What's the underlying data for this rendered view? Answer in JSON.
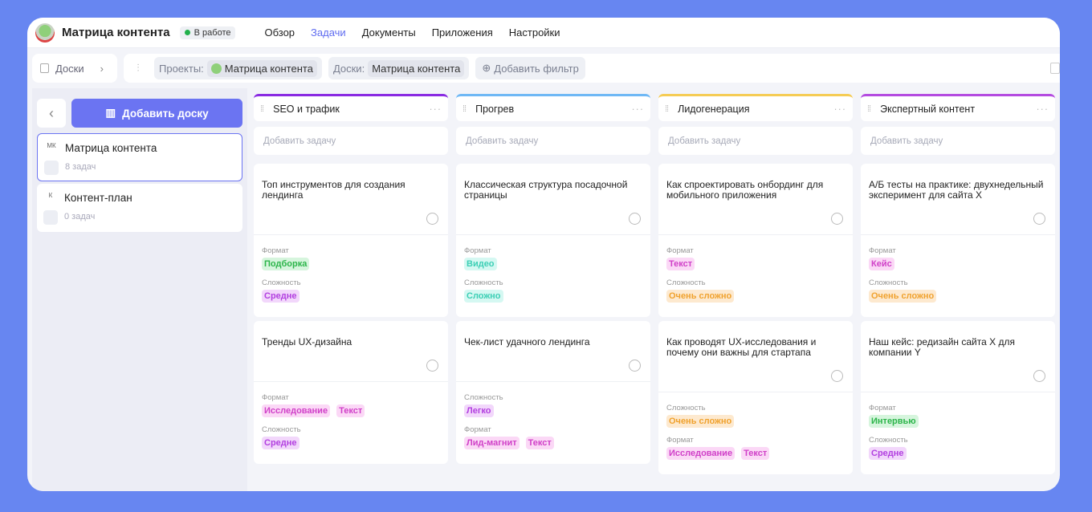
{
  "header": {
    "title": "Матрица контента",
    "status": "В работе",
    "nav": [
      "Обзор",
      "Задачи",
      "Документы",
      "Приложения",
      "Настройки"
    ],
    "active_nav": 1
  },
  "toolbar": {
    "boards_label": "Доски",
    "projects_label": "Проекты:",
    "projects_value": "Матрица контента",
    "boards_filter_label": "Доски:",
    "boards_filter_value": "Матрица контента",
    "add_filter": "Добавить фильтр"
  },
  "sidebar": {
    "add_board": "Добавить доску",
    "boards": [
      {
        "abbr": "МК",
        "name": "Матрица контента",
        "count": "8 задач",
        "selected": true
      },
      {
        "abbr": "К",
        "name": "Контент-план",
        "count": "0 задач",
        "selected": false
      }
    ]
  },
  "colors": {
    "accent": "#6b74f2",
    "background": "#6786f1"
  },
  "columns": [
    {
      "title": "SEO и трафик",
      "color": "#8a2be2",
      "add": "Добавить задачу",
      "cards": [
        {
          "title": "Топ инструментов для создания лендинга",
          "props": [
            {
              "label": "Формат",
              "tags": [
                {
                  "t": "Подборка",
                  "c": "green"
                }
              ]
            },
            {
              "label": "Сложность",
              "tags": [
                {
                  "t": "Средне",
                  "c": "purple"
                }
              ]
            }
          ]
        },
        {
          "title": "Тренды UX-дизайна",
          "props": [
            {
              "label": "Формат",
              "tags": [
                {
                  "t": "Исследование",
                  "c": "pink"
                },
                {
                  "t": "Текст",
                  "c": "pink"
                }
              ]
            },
            {
              "label": "Сложность",
              "tags": [
                {
                  "t": "Средне",
                  "c": "purple"
                }
              ]
            }
          ]
        }
      ]
    },
    {
      "title": "Прогрев",
      "color": "#6fb8f5",
      "add": "Добавить задачу",
      "cards": [
        {
          "title": "Классическая структура посадочной страницы",
          "props": [
            {
              "label": "Формат",
              "tags": [
                {
                  "t": "Видео",
                  "c": "teal"
                }
              ]
            },
            {
              "label": "Сложность",
              "tags": [
                {
                  "t": "Сложно",
                  "c": "teal"
                }
              ]
            }
          ]
        },
        {
          "title": "Чек-лист удачного лендинга",
          "props": [
            {
              "label": "Сложность",
              "tags": [
                {
                  "t": "Легко",
                  "c": "purple"
                }
              ]
            },
            {
              "label": "Формат",
              "tags": [
                {
                  "t": "Лид-магнит",
                  "c": "pink"
                },
                {
                  "t": "Текст",
                  "c": "pink"
                }
              ]
            }
          ]
        }
      ]
    },
    {
      "title": "Лидогенерация",
      "color": "#f5cc55",
      "add": "Добавить задачу",
      "cards": [
        {
          "title": "Как спроектировать онбординг для мобильного приложения",
          "props": [
            {
              "label": "Формат",
              "tags": [
                {
                  "t": "Текст",
                  "c": "pink"
                }
              ]
            },
            {
              "label": "Сложность",
              "tags": [
                {
                  "t": "Очень сложно",
                  "c": "orange"
                }
              ]
            }
          ]
        },
        {
          "title": "Как проводят UX-исследования и почему они важны для стартапа",
          "props": [
            {
              "label": "Сложность",
              "tags": [
                {
                  "t": "Очень сложно",
                  "c": "orange"
                }
              ]
            },
            {
              "label": "Формат",
              "tags": [
                {
                  "t": "Исследование",
                  "c": "pink"
                },
                {
                  "t": "Текст",
                  "c": "pink"
                }
              ]
            }
          ]
        }
      ]
    },
    {
      "title": "Экспертный контент",
      "color": "#b44be0",
      "add": "Добавить задачу",
      "cards": [
        {
          "title": "А/Б тесты на практике: двухнедельный эксперимент для сайта Х",
          "props": [
            {
              "label": "Формат",
              "tags": [
                {
                  "t": "Кейс",
                  "c": "pink"
                }
              ]
            },
            {
              "label": "Сложность",
              "tags": [
                {
                  "t": "Очень сложно",
                  "c": "orange"
                }
              ]
            }
          ]
        },
        {
          "title": "Наш кейс: редизайн сайта Х для компании Y",
          "props": [
            {
              "label": "Формат",
              "tags": [
                {
                  "t": "Интервью",
                  "c": "green"
                }
              ]
            },
            {
              "label": "Сложность",
              "tags": [
                {
                  "t": "Средне",
                  "c": "purple"
                }
              ]
            }
          ]
        }
      ]
    }
  ]
}
